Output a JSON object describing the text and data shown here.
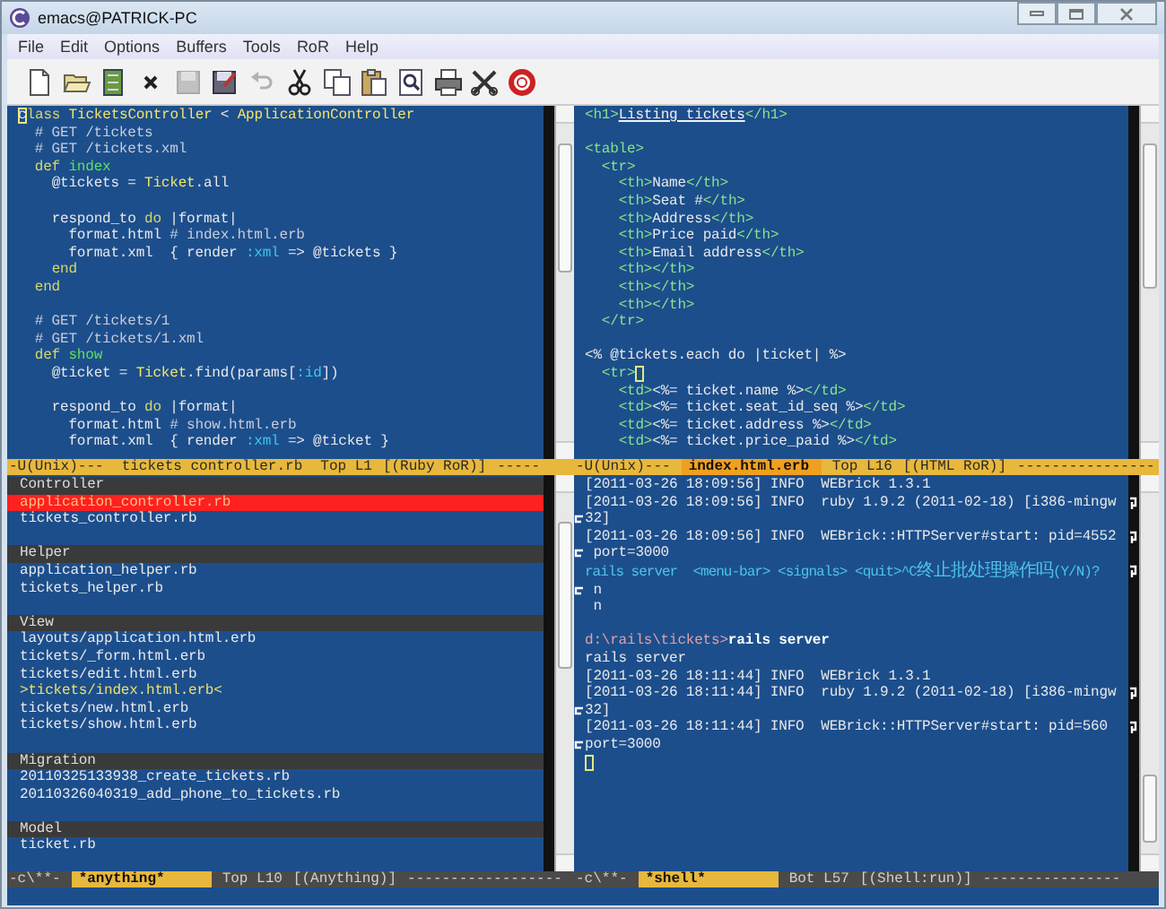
{
  "window": {
    "title": "emacs@PATRICK-PC"
  },
  "menu": [
    "File",
    "Edit",
    "Options",
    "Buffers",
    "Tools",
    "RoR",
    "Help"
  ],
  "toolbar": [
    {
      "kind": "new",
      "disabled": false
    },
    {
      "kind": "open",
      "disabled": false
    },
    {
      "kind": "directory",
      "disabled": false
    },
    {
      "kind": "close",
      "disabled": false
    },
    {
      "kind": "save",
      "disabled": true
    },
    {
      "kind": "save-as",
      "disabled": false
    },
    {
      "kind": "undo",
      "disabled": true
    },
    {
      "kind": "cut",
      "disabled": false
    },
    {
      "kind": "copy",
      "disabled": false
    },
    {
      "kind": "paste",
      "disabled": false
    },
    {
      "kind": "search",
      "disabled": false
    },
    {
      "kind": "print",
      "disabled": false
    },
    {
      "kind": "preferences",
      "disabled": false
    },
    {
      "kind": "help",
      "disabled": false
    }
  ],
  "windows": [
    {
      "kind": "code",
      "blocks": [
        [
          [
            {
              "text": "c",
              "kind": "cursor"
            },
            {
              "text": "lass",
              "kind": "keyword"
            },
            {
              "text": " TicketsController",
              "kind": "constant"
            },
            {
              "text": " < ",
              "kind": "plain"
            },
            {
              "text": "ApplicationController",
              "kind": "constant"
            }
          ],
          [
            {
              "text": "  # GET /tickets",
              "kind": "comment"
            }
          ],
          [
            {
              "text": "  # GET /tickets.xml",
              "kind": "comment"
            }
          ],
          [
            {
              "text": "  def ",
              "kind": "keyword"
            },
            {
              "text": "index",
              "kind": "function"
            }
          ],
          [
            {
              "text": "    @tickets = ",
              "kind": "plain"
            },
            {
              "text": "Ticket",
              "kind": "constant"
            },
            {
              "text": ".all",
              "kind": "plain"
            }
          ]
        ],
        [
          [
            {
              "text": "    respond_to ",
              "kind": "plain"
            },
            {
              "text": "do",
              "kind": "keyword"
            },
            {
              "text": " |format|",
              "kind": "plain"
            }
          ],
          [
            {
              "text": "      format.html ",
              "kind": "plain"
            },
            {
              "text": "# index.html.erb",
              "kind": "comment"
            }
          ],
          [
            {
              "text": "      format.xml  { render ",
              "kind": "plain"
            },
            {
              "text": ":xml",
              "kind": "symbol"
            },
            {
              "text": " => @tickets }",
              "kind": "plain"
            }
          ],
          [
            {
              "text": "    end",
              "kind": "keyword"
            }
          ],
          [
            {
              "text": "  end",
              "kind": "keyword"
            }
          ]
        ],
        [
          [
            {
              "text": "  # GET /tickets/1",
              "kind": "comment"
            }
          ],
          [
            {
              "text": "  # GET /tickets/1.xml",
              "kind": "comment"
            }
          ],
          [
            {
              "text": "  def ",
              "kind": "keyword"
            },
            {
              "text": "show",
              "kind": "function"
            }
          ],
          [
            {
              "text": "    @ticket = ",
              "kind": "plain"
            },
            {
              "text": "Ticket",
              "kind": "constant"
            },
            {
              "text": ".find(params[",
              "kind": "plain"
            },
            {
              "text": ":id",
              "kind": "symbol"
            },
            {
              "text": "])",
              "kind": "plain"
            }
          ]
        ],
        [
          [
            {
              "text": "    respond_to ",
              "kind": "plain"
            },
            {
              "text": "do",
              "kind": "keyword"
            },
            {
              "text": " |format|",
              "kind": "plain"
            }
          ],
          [
            {
              "text": "      format.html ",
              "kind": "plain"
            },
            {
              "text": "# show.html.erb",
              "kind": "comment"
            }
          ],
          [
            {
              "text": "      format.xml  { render ",
              "kind": "plain"
            },
            {
              "text": ":xml",
              "kind": "symbol"
            },
            {
              "text": " => @ticket }",
              "kind": "plain"
            }
          ]
        ]
      ],
      "mode_line": {
        "kind": "light",
        "status": "-U(Unix)---",
        "buffer": "tickets controller.rb",
        "highlighted": false,
        "position": "Top L1",
        "mode": "[(Ruby RoR)]",
        "fill": "-----"
      }
    },
    {
      "kind": "code",
      "blocks": [
        [
          [
            {
              "text": "<h1>",
              "kind": "tag"
            },
            {
              "text": "Listing tickets",
              "kind": "heading"
            },
            {
              "text": "</h1>",
              "kind": "tag"
            }
          ]
        ],
        [
          [
            {
              "text": "<table>",
              "kind": "tag"
            }
          ],
          [
            {
              "text": "  <tr>",
              "kind": "tag"
            }
          ],
          [
            {
              "text": "    <th>",
              "kind": "tag"
            },
            {
              "text": "Name",
              "kind": "plain"
            },
            {
              "text": "</th>",
              "kind": "tag"
            }
          ],
          [
            {
              "text": "    <th>",
              "kind": "tag"
            },
            {
              "text": "Seat #",
              "kind": "plain"
            },
            {
              "text": "</th>",
              "kind": "tag"
            }
          ],
          [
            {
              "text": "    <th>",
              "kind": "tag"
            },
            {
              "text": "Address",
              "kind": "plain"
            },
            {
              "text": "</th>",
              "kind": "tag"
            }
          ],
          [
            {
              "text": "    <th>",
              "kind": "tag"
            },
            {
              "text": "Price paid",
              "kind": "plain"
            },
            {
              "text": "</th>",
              "kind": "tag"
            }
          ],
          [
            {
              "text": "    <th>",
              "kind": "tag"
            },
            {
              "text": "Email address",
              "kind": "plain"
            },
            {
              "text": "</th>",
              "kind": "tag"
            }
          ],
          [
            {
              "text": "    <th></th>",
              "kind": "tag"
            }
          ],
          [
            {
              "text": "    <th></th>",
              "kind": "tag"
            }
          ],
          [
            {
              "text": "    <th></th>",
              "kind": "tag"
            }
          ],
          [
            {
              "text": "  </tr>",
              "kind": "tag"
            }
          ]
        ],
        [
          [
            {
              "text": "<% @tickets.each do |ticket| %>",
              "kind": "plain"
            }
          ],
          [
            {
              "text": "  <tr>",
              "kind": "tag"
            },
            {
              "kind": "cursor"
            }
          ],
          [
            {
              "text": "    <td>",
              "kind": "tag"
            },
            {
              "text": "<%= ticket.name %>",
              "kind": "plain"
            },
            {
              "text": "</td>",
              "kind": "tag"
            }
          ],
          [
            {
              "text": "    <td>",
              "kind": "tag"
            },
            {
              "text": "<%= ticket.seat_id_seq %>",
              "kind": "plain"
            },
            {
              "text": "</td>",
              "kind": "tag"
            }
          ],
          [
            {
              "text": "    <td>",
              "kind": "tag"
            },
            {
              "text": "<%= ticket.address %>",
              "kind": "plain"
            },
            {
              "text": "</td>",
              "kind": "tag"
            }
          ],
          [
            {
              "text": "    <td>",
              "kind": "tag"
            },
            {
              "text": "<%= ticket.price_paid %>",
              "kind": "plain"
            },
            {
              "text": "</td>",
              "kind": "tag"
            }
          ]
        ]
      ],
      "mode_line": {
        "kind": "light",
        "status": "-U(Unix)---",
        "buffer": "index.html.erb",
        "highlighted": true,
        "position": "Top L16",
        "mode": "[(HTML RoR)]",
        "fill": "----------------"
      }
    },
    {
      "kind": "anything",
      "sections": [
        {
          "header": "Controller",
          "items": [
            {
              "text": "application_controller.rb",
              "selected": true,
              "current": false
            },
            {
              "text": "tickets_controller.rb",
              "selected": false,
              "current": false
            }
          ]
        },
        {
          "header": "Helper",
          "items": [
            {
              "text": "application_helper.rb",
              "selected": false,
              "current": false
            },
            {
              "text": "tickets_helper.rb",
              "selected": false,
              "current": false
            }
          ]
        },
        {
          "header": "View",
          "items": [
            {
              "text": "layouts/application.html.erb",
              "selected": false,
              "current": false
            },
            {
              "text": "tickets/_form.html.erb",
              "selected": false,
              "current": false
            },
            {
              "text": "tickets/edit.html.erb",
              "selected": false,
              "current": false
            },
            {
              "text": ">tickets/index.html.erb<",
              "selected": false,
              "current": true
            },
            {
              "text": "tickets/new.html.erb",
              "selected": false,
              "current": false
            },
            {
              "text": "tickets/show.html.erb",
              "selected": false,
              "current": false
            }
          ]
        },
        {
          "header": "Migration",
          "items": [
            {
              "text": "20110325133938_create_tickets.rb",
              "selected": false,
              "current": false
            },
            {
              "text": "20110326040319_add_phone_to_tickets.rb",
              "selected": false,
              "current": false
            }
          ]
        },
        {
          "header": "Model",
          "items": [
            {
              "text": "ticket.rb",
              "selected": false,
              "current": false
            }
          ]
        }
      ],
      "mode_line": {
        "kind": "dark",
        "status": "-c\\**-",
        "buffer": "*anything*",
        "highlighted": true,
        "position": "Top L10",
        "mode": "[(Anything)]",
        "fill": "------------------"
      }
    },
    {
      "kind": "shell",
      "blocks": [
        [
          [
            {
              "text": "[2011-03-26 18:09:56] INFO  WEBrick 1.3.1",
              "kind": "plain"
            }
          ],
          [
            {
              "text": "[2011-03-26 18:09:56] INFO  ruby 1.9.2 (2011-02-18) [i386-mingw",
              "kind": "plain"
            },
            {
              "kind": "wrap"
            }
          ],
          [
            {
              "kind": "continued"
            },
            {
              "text": "32]",
              "kind": "plain"
            }
          ],
          [
            {
              "text": "[2011-03-26 18:09:56] INFO  WEBrick::HTTPServer#start: pid=4552",
              "kind": "plain"
            },
            {
              "kind": "wrap"
            }
          ],
          [
            {
              "kind": "continued"
            },
            {
              "text": " port=3000",
              "kind": "plain"
            }
          ],
          [
            {
              "text": "rails server  <menu-bar> <signals> <quit>^C",
              "kind": "notice"
            },
            {
              "text": "终止批处理操作吗",
              "kind": "notice-cjk"
            },
            {
              "text": "(Y/N)?",
              "kind": "notice"
            },
            {
              "kind": "wrap"
            }
          ],
          [
            {
              "kind": "continued"
            },
            {
              "text": " n",
              "kind": "plain"
            }
          ],
          [
            {
              "text": " n",
              "kind": "plain"
            }
          ]
        ],
        [
          [
            {
              "text": "d:\\rails\\tickets>",
              "kind": "prompt"
            },
            {
              "text": "rails server",
              "kind": "command"
            }
          ],
          [
            {
              "text": "rails server",
              "kind": "plain"
            }
          ],
          [
            {
              "text": "[2011-03-26 18:11:44] INFO  WEBrick 1.3.1",
              "kind": "plain"
            }
          ],
          [
            {
              "text": "[2011-03-26 18:11:44] INFO  ruby 1.9.2 (2011-02-18) [i386-mingw",
              "kind": "plain"
            },
            {
              "kind": "wrap"
            }
          ],
          [
            {
              "kind": "continued"
            },
            {
              "text": "32]",
              "kind": "plain"
            }
          ],
          [
            {
              "text": "[2011-03-26 18:11:44] INFO  WEBrick::HTTPServer#start: pid=560 ",
              "kind": "plain"
            },
            {
              "kind": "wrap"
            }
          ],
          [
            {
              "kind": "continued"
            },
            {
              "text": "port=3000",
              "kind": "plain"
            }
          ],
          [
            {
              "kind": "cursor"
            }
          ]
        ]
      ],
      "mode_line": {
        "kind": "dark",
        "status": "-c\\**-",
        "buffer": "*shell*",
        "highlighted": true,
        "position": "Bot L57",
        "mode": "[(Shell:run)]",
        "fill": "----------------"
      }
    }
  ]
}
